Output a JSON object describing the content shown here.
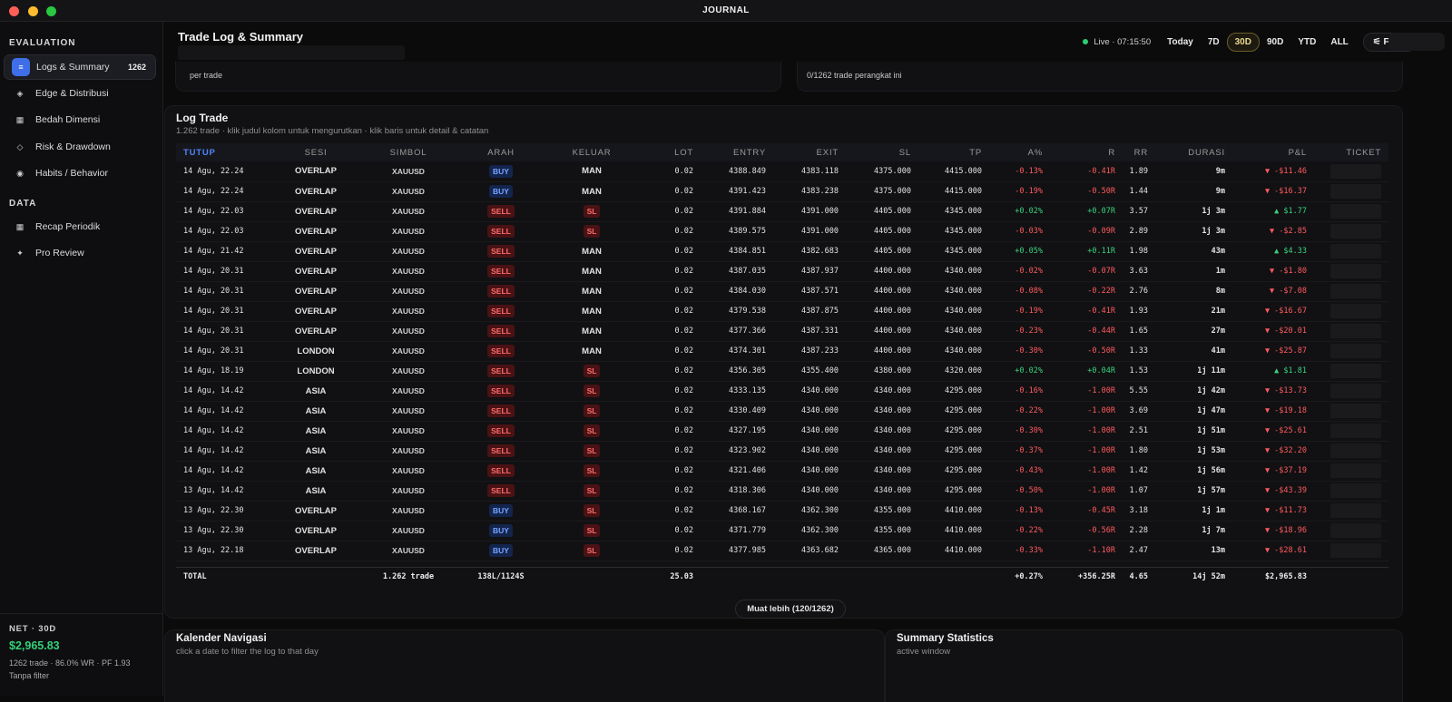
{
  "app": {
    "title": "JOURNAL"
  },
  "sidebar": {
    "sections": [
      {
        "label": "EVALUATION"
      },
      {
        "label": "DATA"
      }
    ],
    "items": [
      {
        "label": "Logs & Summary",
        "badge": "1262",
        "icon": "list-icon"
      },
      {
        "label": "Edge & Distribusi",
        "icon": "diamond-icon"
      },
      {
        "label": "Bedah Dimensi",
        "icon": "grid-icon"
      },
      {
        "label": "Risk & Drawdown",
        "icon": "shield-icon"
      },
      {
        "label": "Habits / Behavior",
        "icon": "target-icon"
      },
      {
        "label": "Recap Periodik",
        "icon": "calendar-icon"
      },
      {
        "label": "Pro Review",
        "icon": "sparkle-icon"
      }
    ],
    "footer": {
      "label": "NET · 30D",
      "value": "$2,965.83",
      "stats": "1262 trade · 86.0% WR · PF 1.93",
      "filter": "Tanpa filter"
    }
  },
  "header": {
    "title": "Trade Log & Summary",
    "live": "Live · 07:15:50",
    "ranges": [
      "Today",
      "7D",
      "30D",
      "90D",
      "YTD",
      "ALL"
    ],
    "active_range": "30D",
    "filter_label": "⚟ Filter"
  },
  "summary_cards": {
    "left_text": "per trade",
    "right_text": "0/1262 trade perangkat ini"
  },
  "log": {
    "title": "Log Trade",
    "subtitle": "1.262 trade · klik judul kolom untuk mengurutkan · klik baris untuk detail & catatan",
    "columns": [
      "TUTUP",
      "SESI",
      "SIMBOL",
      "ARAH",
      "KELUAR",
      "LOT",
      "ENTRY",
      "EXIT",
      "SL",
      "TP",
      "A%",
      "R",
      "RR",
      "DURASI",
      "P&L",
      "TICKET"
    ],
    "rows": [
      [
        "14 Agu, 22.24",
        "OVERLAP",
        "XAUUSD",
        "BUY",
        "MAN",
        "0.02",
        "4388.849",
        "4383.118",
        "4375.000",
        "4415.000",
        "-0.13%",
        "-0.41R",
        "1.89",
        "9m",
        "▼ -$11.46"
      ],
      [
        "14 Agu, 22.24",
        "OVERLAP",
        "XAUUSD",
        "BUY",
        "MAN",
        "0.02",
        "4391.423",
        "4383.238",
        "4375.000",
        "4415.000",
        "-0.19%",
        "-0.50R",
        "1.44",
        "9m",
        "▼ -$16.37"
      ],
      [
        "14 Agu, 22.03",
        "OVERLAP",
        "XAUUSD",
        "SELL",
        "SL",
        "0.02",
        "4391.884",
        "4391.000",
        "4405.000",
        "4345.000",
        "+0.02%",
        "+0.07R",
        "3.57",
        "1j 3m",
        "▲ $1.77"
      ],
      [
        "14 Agu, 22.03",
        "OVERLAP",
        "XAUUSD",
        "SELL",
        "SL",
        "0.02",
        "4389.575",
        "4391.000",
        "4405.000",
        "4345.000",
        "-0.03%",
        "-0.09R",
        "2.89",
        "1j 3m",
        "▼ -$2.85"
      ],
      [
        "14 Agu, 21.42",
        "OVERLAP",
        "XAUUSD",
        "SELL",
        "MAN",
        "0.02",
        "4384.851",
        "4382.683",
        "4405.000",
        "4345.000",
        "+0.05%",
        "+0.11R",
        "1.98",
        "43m",
        "▲ $4.33"
      ],
      [
        "14 Agu, 20.31",
        "OVERLAP",
        "XAUUSD",
        "SELL",
        "MAN",
        "0.02",
        "4387.035",
        "4387.937",
        "4400.000",
        "4340.000",
        "-0.02%",
        "-0.07R",
        "3.63",
        "1m",
        "▼ -$1.80"
      ],
      [
        "14 Agu, 20.31",
        "OVERLAP",
        "XAUUSD",
        "SELL",
        "MAN",
        "0.02",
        "4384.030",
        "4387.571",
        "4400.000",
        "4340.000",
        "-0.08%",
        "-0.22R",
        "2.76",
        "8m",
        "▼ -$7.08"
      ],
      [
        "14 Agu, 20.31",
        "OVERLAP",
        "XAUUSD",
        "SELL",
        "MAN",
        "0.02",
        "4379.538",
        "4387.875",
        "4400.000",
        "4340.000",
        "-0.19%",
        "-0.41R",
        "1.93",
        "21m",
        "▼ -$16.67"
      ],
      [
        "14 Agu, 20.31",
        "OVERLAP",
        "XAUUSD",
        "SELL",
        "MAN",
        "0.02",
        "4377.366",
        "4387.331",
        "4400.000",
        "4340.000",
        "-0.23%",
        "-0.44R",
        "1.65",
        "27m",
        "▼ -$20.01"
      ],
      [
        "14 Agu, 20.31",
        "LONDON",
        "XAUUSD",
        "SELL",
        "MAN",
        "0.02",
        "4374.301",
        "4387.233",
        "4400.000",
        "4340.000",
        "-0.30%",
        "-0.50R",
        "1.33",
        "41m",
        "▼ -$25.87"
      ],
      [
        "14 Agu, 18.19",
        "LONDON",
        "XAUUSD",
        "SELL",
        "SL",
        "0.02",
        "4356.305",
        "4355.400",
        "4380.000",
        "4320.000",
        "+0.02%",
        "+0.04R",
        "1.53",
        "1j 11m",
        "▲ $1.81"
      ],
      [
        "14 Agu, 14.42",
        "ASIA",
        "XAUUSD",
        "SELL",
        "SL",
        "0.02",
        "4333.135",
        "4340.000",
        "4340.000",
        "4295.000",
        "-0.16%",
        "-1.00R",
        "5.55",
        "1j 42m",
        "▼ -$13.73"
      ],
      [
        "14 Agu, 14.42",
        "ASIA",
        "XAUUSD",
        "SELL",
        "SL",
        "0.02",
        "4330.409",
        "4340.000",
        "4340.000",
        "4295.000",
        "-0.22%",
        "-1.00R",
        "3.69",
        "1j 47m",
        "▼ -$19.18"
      ],
      [
        "14 Agu, 14.42",
        "ASIA",
        "XAUUSD",
        "SELL",
        "SL",
        "0.02",
        "4327.195",
        "4340.000",
        "4340.000",
        "4295.000",
        "-0.30%",
        "-1.00R",
        "2.51",
        "1j 51m",
        "▼ -$25.61"
      ],
      [
        "14 Agu, 14.42",
        "ASIA",
        "XAUUSD",
        "SELL",
        "SL",
        "0.02",
        "4323.902",
        "4340.000",
        "4340.000",
        "4295.000",
        "-0.37%",
        "-1.00R",
        "1.80",
        "1j 53m",
        "▼ -$32.20"
      ],
      [
        "14 Agu, 14.42",
        "ASIA",
        "XAUUSD",
        "SELL",
        "SL",
        "0.02",
        "4321.406",
        "4340.000",
        "4340.000",
        "4295.000",
        "-0.43%",
        "-1.00R",
        "1.42",
        "1j 56m",
        "▼ -$37.19"
      ],
      [
        "13 Agu, 14.42",
        "ASIA",
        "XAUUSD",
        "SELL",
        "SL",
        "0.02",
        "4318.306",
        "4340.000",
        "4340.000",
        "4295.000",
        "-0.50%",
        "-1.00R",
        "1.07",
        "1j 57m",
        "▼ -$43.39"
      ],
      [
        "13 Agu, 22.30",
        "OVERLAP",
        "XAUUSD",
        "BUY",
        "SL",
        "0.02",
        "4368.167",
        "4362.300",
        "4355.000",
        "4410.000",
        "-0.13%",
        "-0.45R",
        "3.18",
        "1j 1m",
        "▼ -$11.73"
      ],
      [
        "13 Agu, 22.30",
        "OVERLAP",
        "XAUUSD",
        "BUY",
        "SL",
        "0.02",
        "4371.779",
        "4362.300",
        "4355.000",
        "4410.000",
        "-0.22%",
        "-0.56R",
        "2.28",
        "1j 7m",
        "▼ -$18.96"
      ],
      [
        "13 Agu, 22.18",
        "OVERLAP",
        "XAUUSD",
        "BUY",
        "SL",
        "0.02",
        "4377.985",
        "4363.682",
        "4365.000",
        "4410.000",
        "-0.33%",
        "-1.10R",
        "2.47",
        "13m",
        "▼ -$28.61"
      ]
    ],
    "total": {
      "label": "TOTAL",
      "trades": "1.262 trade",
      "direction": "138L/1124S",
      "lot": "25.03",
      "a_pct": "+0.27%",
      "r": "+356.25R",
      "rr": "4.65",
      "durasi": "14j 52m",
      "pnl": "$2,965.83"
    },
    "load_more": "Muat lebih (120/1262)"
  },
  "bottom": {
    "calendar_title": "Kalender Navigasi",
    "calendar_sub": "click a date to filter the log to that day",
    "stats_title": "Summary Statistics",
    "stats_sub": "active window"
  },
  "colors": {
    "accent": "#3f6ee8",
    "positive": "#39d37f",
    "negative": "#ff5a5f",
    "active_range": "#e9d98e"
  }
}
